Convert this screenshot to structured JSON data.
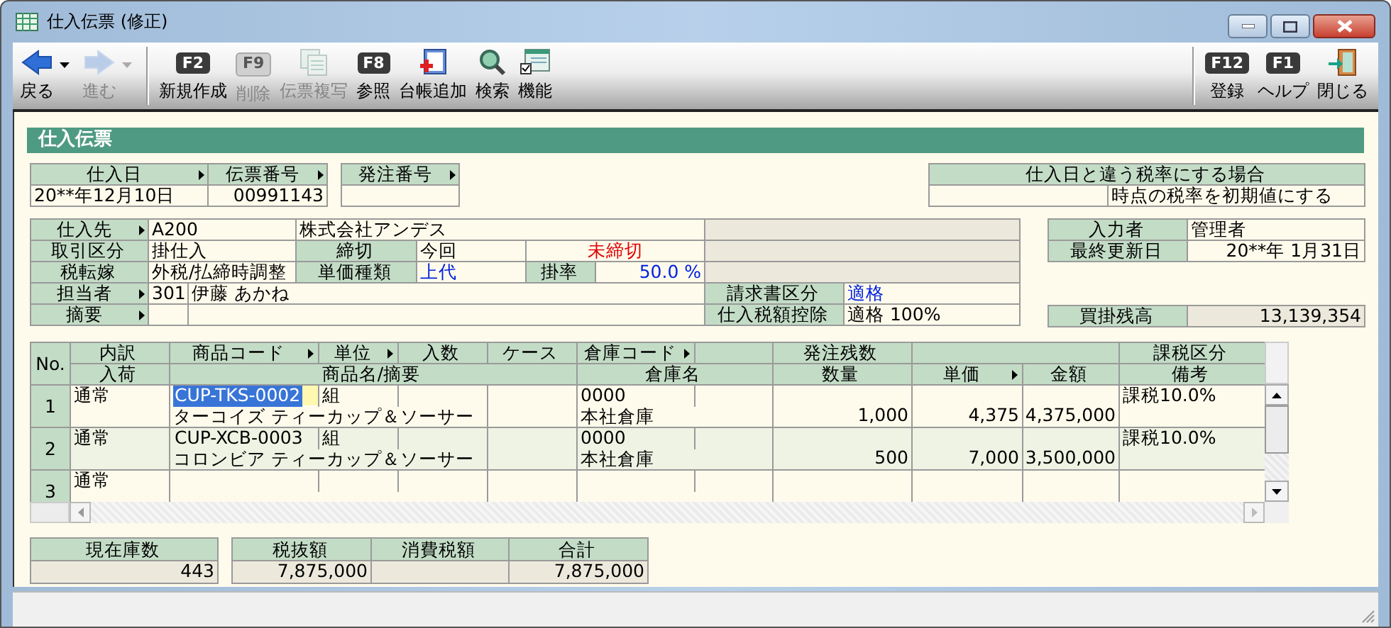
{
  "window": {
    "title": "仕入伝票 (修正)"
  },
  "toolbar": {
    "left": [
      {
        "label": "戻る",
        "kind": "back",
        "disabled": false
      },
      {
        "label": "進む",
        "kind": "forward",
        "disabled": true
      },
      {
        "label": "新規作成",
        "kind": "key",
        "key": "F2",
        "disabled": false
      },
      {
        "label": "削除",
        "kind": "key",
        "key": "F9",
        "disabled": true
      },
      {
        "label": "伝票複写",
        "kind": "copy",
        "disabled": true
      },
      {
        "label": "参照",
        "kind": "key",
        "key": "F8",
        "disabled": false
      },
      {
        "label": "台帳追加",
        "kind": "ledger",
        "disabled": false
      },
      {
        "label": "検索",
        "kind": "search",
        "disabled": false
      },
      {
        "label": "機能",
        "kind": "function",
        "disabled": false
      }
    ],
    "right": [
      {
        "label": "登録",
        "kind": "key",
        "key": "F12",
        "disabled": false
      },
      {
        "label": "ヘルプ",
        "kind": "key",
        "key": "F1",
        "disabled": false
      },
      {
        "label": "閉じる",
        "kind": "exit",
        "disabled": false
      }
    ]
  },
  "section_title": "仕入伝票",
  "header": {
    "purchase_date": {
      "label": "仕入日",
      "lookup": true,
      "value": "20**年12月10日"
    },
    "slip_number": {
      "label": "伝票番号",
      "lookup": true,
      "value": "00991143"
    },
    "order_number": {
      "label": "発注番号",
      "lookup": true
    },
    "tax_rate_option": {
      "label": "仕入日と違う税率にする場合",
      "value": "時点の税率を初期値にする"
    }
  },
  "details": {
    "supplier": {
      "label": "仕入先",
      "lookup": true,
      "code": "A200",
      "name": "株式会社アンデス"
    },
    "transaction_type": {
      "label": "取引区分",
      "value": "掛仕入"
    },
    "closing": {
      "label": "締切",
      "value": "今回",
      "status": "未締切"
    },
    "tax_shift": {
      "label": "税転嫁",
      "value": "外税/払締時調整"
    },
    "price_type": {
      "label": "単価種類",
      "value": "上代"
    },
    "rate": {
      "label": "掛率",
      "value": "50.0 %"
    },
    "staff": {
      "label": "担当者",
      "lookup": true,
      "code": "301",
      "name": "伊藤 あかね"
    },
    "memo": {
      "label": "摘要",
      "lookup": true
    },
    "invoice_type": {
      "label": "請求書区分",
      "value": "適格"
    },
    "tax_deduction": {
      "label": "仕入税額控除",
      "value": "適格 100%"
    },
    "entered_by": {
      "label": "入力者",
      "value": "管理者"
    },
    "last_updated": {
      "label": "最終更新日",
      "value": "20**年 1月31日"
    },
    "payable_balance": {
      "label": "買掛残高",
      "value": "13,139,354"
    }
  },
  "table": {
    "no_label": "No.",
    "columns_top": [
      {
        "label": "内訳",
        "lookup": false
      },
      {
        "label": "商品コード",
        "lookup": true
      },
      {
        "label": "単位",
        "lookup": true
      },
      {
        "label": "入数",
        "lookup": false
      },
      {
        "label": "ケース",
        "lookup": false
      },
      {
        "label": "倉庫コード",
        "lookup": true
      },
      {
        "label": "発注残数",
        "lookup": false
      },
      {
        "label": "課税区分",
        "lookup": false
      }
    ],
    "columns_bottom": [
      {
        "label": "入荷",
        "lookup": false
      },
      {
        "label": "商品名/摘要",
        "lookup": false
      },
      {
        "label": "倉庫名",
        "lookup": false
      },
      {
        "label": "数量",
        "lookup": false
      },
      {
        "label": "単価",
        "lookup": true
      },
      {
        "label": "金額",
        "lookup": false
      },
      {
        "label": "備考",
        "lookup": false
      }
    ],
    "rows": [
      {
        "no": "1",
        "breakdown": "通常",
        "code": "CUP-TKS-0002",
        "unit": "組",
        "name": "ターコイズ ティーカップ＆ソーサー",
        "warehouse_code": "0000",
        "warehouse": "本社倉庫",
        "quantity": "1,000",
        "unit_price": "4,375",
        "amount": "4,375,000",
        "tax": "課税10.0%",
        "selected": true
      },
      {
        "no": "2",
        "breakdown": "通常",
        "code": "CUP-XCB-0003",
        "unit": "組",
        "name": "コロンビア ティーカップ＆ソーサー",
        "warehouse_code": "0000",
        "warehouse": "本社倉庫",
        "quantity": "500",
        "unit_price": "7,000",
        "amount": "3,500,000",
        "tax": "課税10.0%",
        "selected": false
      },
      {
        "no": "3",
        "breakdown": "通常",
        "selected": false
      }
    ]
  },
  "footer": {
    "stock": {
      "label": "現在庫数",
      "value": "443"
    },
    "totals": [
      {
        "label": "税抜額",
        "value": "7,875,000"
      },
      {
        "label": "消費税額"
      },
      {
        "label": "合計",
        "value": "7,875,000"
      }
    ]
  }
}
